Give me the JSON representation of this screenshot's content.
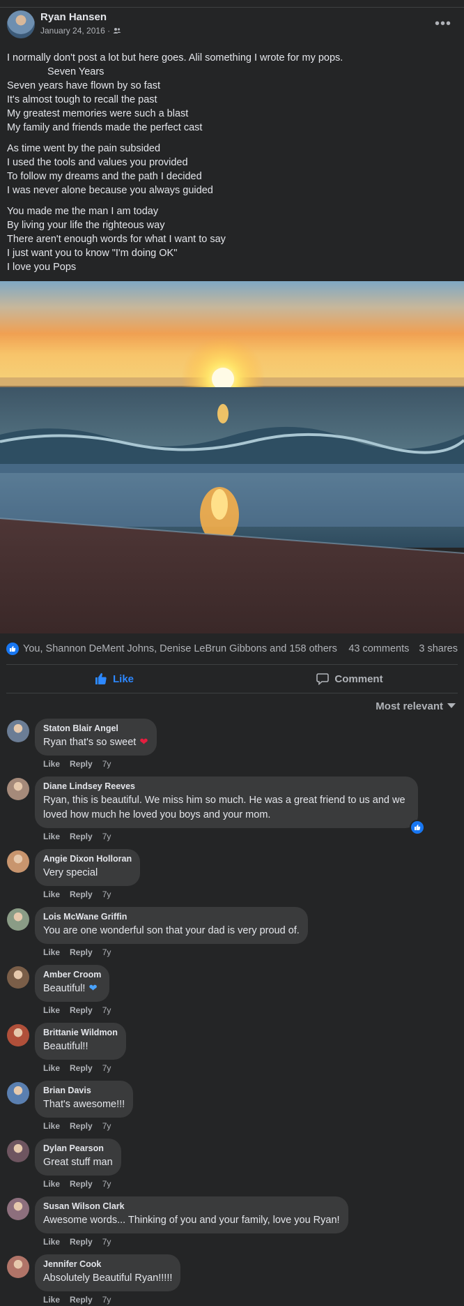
{
  "post": {
    "author": "Ryan Hansen",
    "date": "January 24, 2016 ·",
    "audience_icon": "friends-icon",
    "text_blocks": [
      [
        "I normally don't post a lot but here goes. Alil something I wrote for my pops.",
        "Seven Years",
        "Seven years have flown by so fast",
        "It's almost tough to recall the past",
        "My greatest memories were such a blast",
        "My family and friends made the perfect cast"
      ],
      [
        "As time went by the pain subsided",
        "I used the tools and values you provided",
        "To follow my dreams and the path I decided",
        "I was never alone because you always guided"
      ],
      [
        "You made me the man I am today",
        "By living your life the righteous way",
        "There aren't enough words for what I want to say",
        "I just want you to know \"I'm doing OK\"",
        "I love you Pops"
      ]
    ]
  },
  "reactions": {
    "names": "You, Shannon DeMent Johns, Denise LeBrun Gibbons and 158 others",
    "comments": "43 comments",
    "shares": "3 shares"
  },
  "actions": {
    "like": "Like",
    "comment": "Comment"
  },
  "sort": {
    "label": "Most relevant"
  },
  "comments": [
    {
      "name": "Staton Blair Angel",
      "text": "Ryan that's so sweet",
      "heart": true,
      "like": "Like",
      "reply": "Reply",
      "time": "7y",
      "avatar_color": "#6b7d95"
    },
    {
      "name": "Diane Lindsey Reeves",
      "text": "Ryan, this is beautiful. We miss him so much. He was a great friend to us and we loved how much he loved you boys and your mom.",
      "reacted": true,
      "like": "Like",
      "reply": "Reply",
      "time": "7y",
      "avatar_color": "#a58a7a"
    },
    {
      "name": "Angie Dixon Holloran",
      "text": "Very special",
      "like": "Like",
      "reply": "Reply",
      "time": "7y",
      "avatar_color": "#c8956e"
    },
    {
      "name": "Lois McWane Griffin",
      "text": "You are one wonderful son that your dad is very proud of.",
      "like": "Like",
      "reply": "Reply",
      "time": "7y",
      "avatar_color": "#8a9c86"
    },
    {
      "name": "Amber Croom",
      "text": "Beautiful!",
      "blue_heart": true,
      "like": "Like",
      "reply": "Reply",
      "time": "7y",
      "avatar_color": "#7a5e48"
    },
    {
      "name": "Brittanie Wildmon",
      "text": "Beautiful!!",
      "like": "Like",
      "reply": "Reply",
      "time": "7y",
      "avatar_color": "#b0503a"
    },
    {
      "name": "Brian Davis",
      "text": "That's awesome!!!",
      "like": "Like",
      "reply": "Reply",
      "time": "7y",
      "avatar_color": "#5a7fb0"
    },
    {
      "name": "Dylan Pearson",
      "text": "Great stuff man",
      "like": "Like",
      "reply": "Reply",
      "time": "7y",
      "avatar_color": "#6e5560"
    },
    {
      "name": "Susan Wilson Clark",
      "text": "Awesome words... Thinking of you and your family, love you Ryan!",
      "like": "Like",
      "reply": "Reply",
      "time": "7y",
      "avatar_color": "#8d6f7d"
    },
    {
      "name": "Jennifer Cook",
      "text": "Absolutely Beautiful Ryan!!!!!",
      "like": "Like",
      "reply": "Reply",
      "time": "7y",
      "avatar_color": "#b07468"
    }
  ]
}
